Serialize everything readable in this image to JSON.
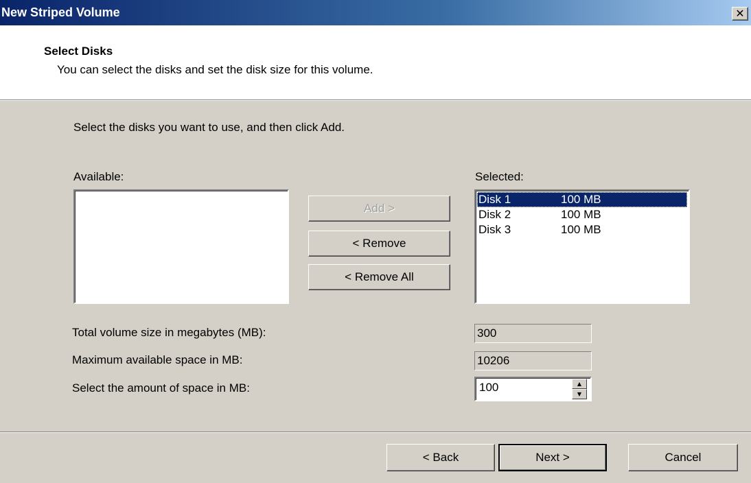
{
  "window": {
    "title": "New Striped Volume",
    "close_glyph": "✕",
    "close_icon": "close-icon"
  },
  "header": {
    "title": "Select Disks",
    "subtitle": "You can select the disks and set the disk size for this volume."
  },
  "main": {
    "instruction": "Select the disks you want to use, and then click Add.",
    "available_label": "Available:",
    "available_items": [],
    "selected_label": "Selected:",
    "selected_items": [
      {
        "name": "Disk 1",
        "size": "100 MB",
        "selected": true
      },
      {
        "name": "Disk 2",
        "size": "100 MB",
        "selected": false
      },
      {
        "name": "Disk 3",
        "size": "100 MB",
        "selected": false
      }
    ],
    "add_label": "Add >",
    "remove_label": "< Remove",
    "remove_all_label": "< Remove All",
    "total_label": "Total volume size in megabytes (MB):",
    "total_value": "300",
    "max_label": "Maximum available space in MB:",
    "max_value": "10206",
    "amount_label": "Select the amount of space in MB:",
    "amount_value": "100",
    "spin_up_glyph": "▲",
    "spin_down_glyph": "▼"
  },
  "footer": {
    "back_label": "< Back",
    "next_label": "Next >",
    "cancel_label": "Cancel"
  },
  "colors": {
    "titlebar_start": "#0a246a",
    "titlebar_end": "#a6caf0",
    "dialog_bg": "#d4d0c8",
    "selection": "#0a246a"
  }
}
